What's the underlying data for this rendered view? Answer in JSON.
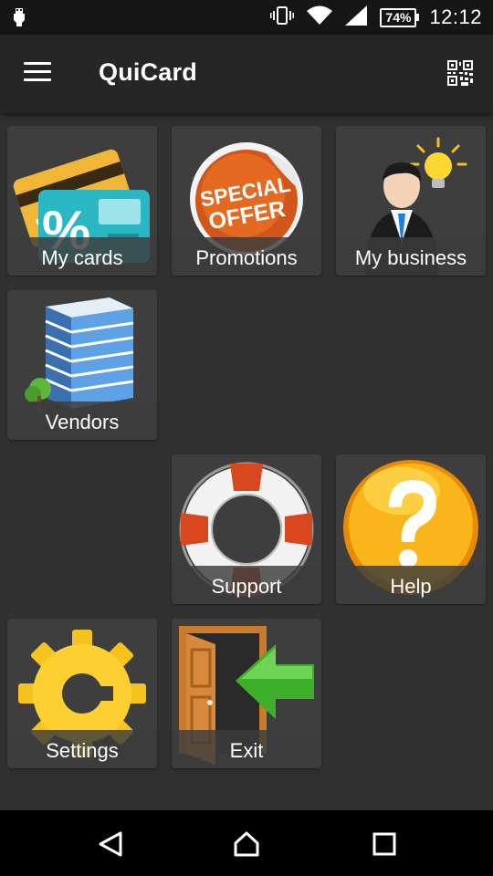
{
  "status_bar": {
    "battery": "74%",
    "time": "12:12",
    "icons": [
      "usb-debug-icon",
      "vibrate-icon",
      "wifi-icon",
      "signal-icon",
      "battery-icon"
    ]
  },
  "app_bar": {
    "title": "QuiCard",
    "menu_icon": "hamburger-menu-icon",
    "action_icon": "qr-code-icon"
  },
  "tiles": [
    {
      "label": "My cards",
      "icon": "credit-cards-icon"
    },
    {
      "label": "Promotions",
      "icon": "special-offer-sticker-icon"
    },
    {
      "label": "My business",
      "icon": "businessman-idea-icon"
    },
    {
      "label": "Vendors",
      "icon": "office-building-icon"
    },
    {
      "label": "Support",
      "icon": "lifebuoy-icon"
    },
    {
      "label": "Help",
      "icon": "question-mark-icon"
    },
    {
      "label": "Settings",
      "icon": "gear-icon"
    },
    {
      "label": "Exit",
      "icon": "exit-door-icon"
    }
  ],
  "promo_sticker_text": [
    "SPECIAL",
    "OFFER"
  ],
  "nav_bar": [
    "back-icon",
    "home-icon",
    "recents-icon"
  ],
  "colors": {
    "background": "#303030",
    "app_bar": "#262626",
    "tile": "#3e3e3e",
    "status_bar": "#161616"
  }
}
